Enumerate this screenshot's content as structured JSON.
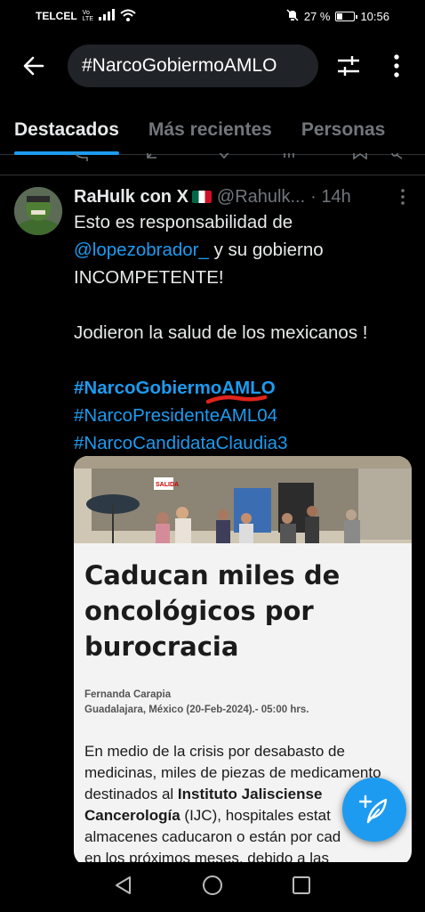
{
  "status_bar": {
    "carrier": "TELCEL",
    "volte_top": "Vo",
    "volte_bottom": "LTE",
    "battery_percent": "27 %",
    "battery_level": 0.27,
    "time": "10:56"
  },
  "top_bar": {
    "search_query": "#NarcoGobiermoAMLO"
  },
  "tabs": [
    {
      "label": "Destacados",
      "active": true
    },
    {
      "label": "Más recientes",
      "active": false
    },
    {
      "label": "Personas",
      "active": false
    }
  ],
  "tweet": {
    "display_name": "RaHulk con X",
    "handle": "@Rahulk...",
    "time": "· 14h",
    "text_line1": "Esto es responsabilidad de",
    "mention": "@lopezobrador_",
    "text_line2_rest": " y su gobierno",
    "text_line3": "INCOMPETENTE!",
    "text_line4": "Jodieron la salud de los mexicanos !",
    "hashtags": [
      "#NarcoGobiermoAMLO",
      "#NarcoPresidenteAML04",
      "#NarcoCandidataClaudia3"
    ]
  },
  "article": {
    "photo_sign": "SALIDA",
    "title_lines": [
      "Caducan miles de",
      "oncológicos por",
      "burocracia"
    ],
    "author": "Fernanda Carapia",
    "dateline": "Guadalajara, México (20-Feb-2024).- 05:00 hrs.",
    "body_line1": "En medio de la crisis por desabasto de",
    "body_line2": "medicinas, miles de piezas de medicamento",
    "body_line3_plain": "destinados al ",
    "body_line3_bold": "Instituto Jalisciense",
    "body_line4_bold": "Cancerología",
    "body_line4_plain": " (IJC), hospitales estat",
    "body_line5": "almacenes caducaron o están por cad",
    "body_line6": "en los próximos meses, debido a las"
  },
  "colors": {
    "accent": "#1d9bf0",
    "background": "#000000",
    "secondary_text": "#71767b"
  }
}
